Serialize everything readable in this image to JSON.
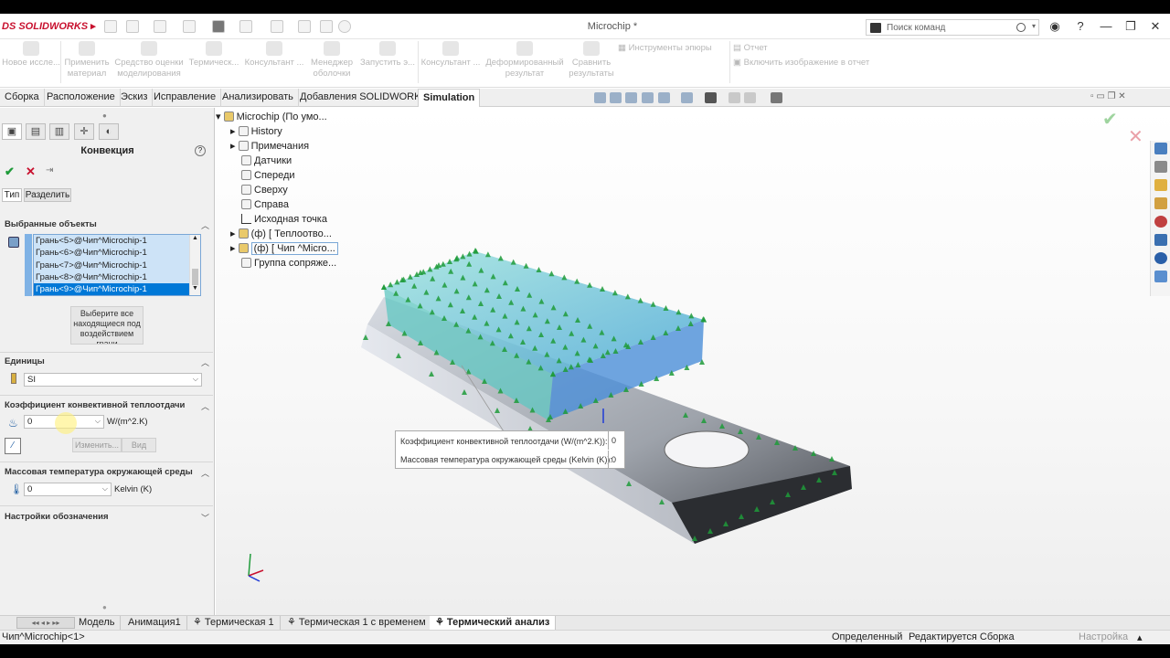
{
  "app": {
    "brand": "SOLIDWORKS",
    "window_title": "Microchip *",
    "search_placeholder": "Поиск команд"
  },
  "ribbon": {
    "items": [
      "Новое иссле...",
      "Применить материал",
      "Средство оценки моделирования",
      "Термическ...",
      "Консультант ...",
      "Менеджер оболочки",
      "Запустить э...",
      "Консультант ...",
      "Деформированный результат",
      "Сравнить результаты",
      "Инструменты эпюры",
      "Отчет",
      "Включить изображение в отчет"
    ]
  },
  "tabs": [
    "Сборка",
    "Расположение",
    "Эскиз",
    "Исправление",
    "Анализировать",
    "Добавления SOLIDWORKS",
    "Simulation"
  ],
  "active_tab": "Simulation",
  "panel": {
    "title": "Конвекция",
    "sub_tabs": [
      "Тип",
      "Разделить"
    ],
    "selected_section": "Выбранные объекты",
    "faces": [
      "Грань<5>@Чип^Microchip-1",
      "Грань<6>@Чип^Microchip-1",
      "Грань<7>@Чип^Microchip-1",
      "Грань<8>@Чип^Microchip-1",
      "Грань<9>@Чип^Microchip-1"
    ],
    "select_all_btn": "Выберите все находящиеся под воздействием грани",
    "units_section": "Единицы",
    "units_value": "SI",
    "coef_section": "Коэффициент конвективной теплоотдачи",
    "coef_value": "0",
    "coef_unit": "W/(m^2.K)",
    "edit_btn": "Изменить...",
    "view_btn": "Вид",
    "temp_section": "Массовая температура окружающей среды",
    "temp_value": "0",
    "temp_unit": "Kelvin (K)",
    "symbol_section": "Настройки обозначения"
  },
  "tree": {
    "root": "Microchip",
    "root_suffix": "(По умо...",
    "items": [
      "History",
      "Примечания",
      "Датчики",
      "Спереди",
      "Сверху",
      "Справа",
      "Исходная точка",
      "(ф) [ Теплоотво...",
      "(ф) [ Чип ^Micro...",
      "Группа сопряже..."
    ]
  },
  "callout": {
    "rows": [
      {
        "label": "Коэффициент конвективной теплоотдачи (W/(m^2.K)):",
        "value": "0"
      },
      {
        "label": "Массовая температура окружающей среды (Kelvin (K)):",
        "value": "0"
      }
    ]
  },
  "bottom_tabs": [
    "Модель",
    "Анимация1",
    "Термическая 1",
    "Термическая 1 с временем",
    "Термический анализ"
  ],
  "active_bottom_tab": "Термический анализ",
  "status": {
    "left": "Чип^Microchip<1>",
    "state": "Определенный",
    "editing": "Редактируется Сборка",
    "settings": "Настройка"
  },
  "colors": {
    "accent": "#0078d7",
    "logo": "#c8102e",
    "arrow_green": "#1f9b3a"
  }
}
